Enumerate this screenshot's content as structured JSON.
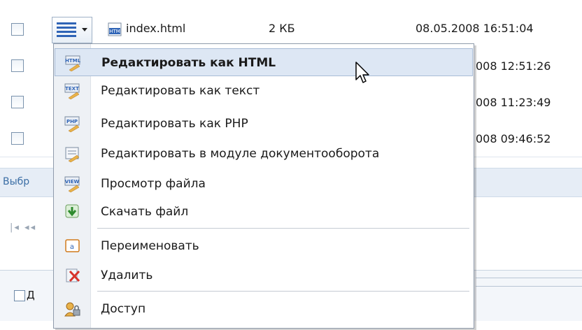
{
  "files": [
    {
      "name": "index.html",
      "size": "2 КБ",
      "modified": "08.05.2008 16:51:04"
    },
    {
      "modified": "008 12:51:26"
    },
    {
      "modified": "008 11:23:49"
    },
    {
      "modified": "008 09:46:52"
    }
  ],
  "selection_bar": {
    "label": "Выбр"
  },
  "pager": {
    "controls": "◂◂"
  },
  "group": {
    "checkbox_label": "Д"
  },
  "context_menu": {
    "items": [
      {
        "label": "Редактировать как HTML",
        "icon": "html-file-icon",
        "highlighted": true
      },
      {
        "label": "Редактировать как текст",
        "icon": "text-file-icon"
      },
      {
        "label": "Редактировать как PHP",
        "icon": "php-file-icon"
      },
      {
        "label": "Редактировать в модуле документооборота",
        "icon": "workflow-icon"
      },
      {
        "label": "Просмотр файла",
        "icon": "view-file-icon"
      },
      {
        "label": "Скачать файл",
        "icon": "download-icon"
      },
      {
        "label": "Переименовать",
        "icon": "rename-icon"
      },
      {
        "label": "Удалить",
        "icon": "delete-icon"
      },
      {
        "label": "Доступ",
        "icon": "access-icon"
      }
    ]
  },
  "colors": {
    "highlight": "#dde7f4",
    "accent": "#2f64b6",
    "link": "#3b6ea5"
  }
}
